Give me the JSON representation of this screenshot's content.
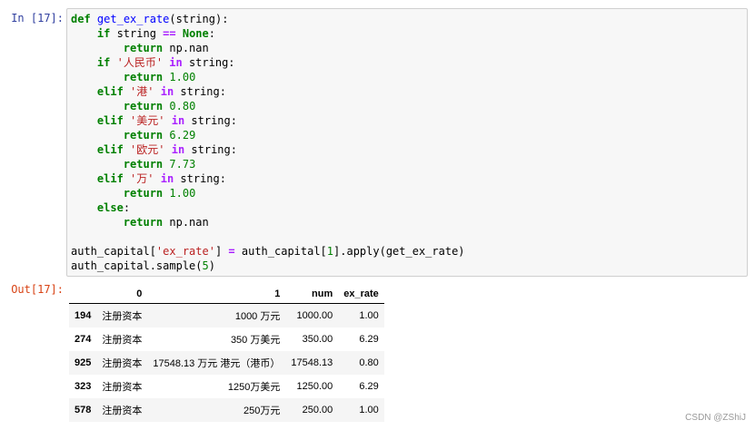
{
  "cell": {
    "in_prompt": "In  [17]:",
    "out_prompt": "Out[17]:",
    "code_lines": [
      [
        {
          "t": "def",
          "c": "kw"
        },
        {
          "t": " "
        },
        {
          "t": "get_ex_rate",
          "c": "fn"
        },
        {
          "t": "(string):"
        }
      ],
      [
        {
          "t": "    "
        },
        {
          "t": "if",
          "c": "kw"
        },
        {
          "t": " string "
        },
        {
          "t": "==",
          "c": "op"
        },
        {
          "t": " "
        },
        {
          "t": "None",
          "c": "kw"
        },
        {
          "t": ":"
        }
      ],
      [
        {
          "t": "        "
        },
        {
          "t": "return",
          "c": "kw"
        },
        {
          "t": " np.nan"
        }
      ],
      [
        {
          "t": "    "
        },
        {
          "t": "if",
          "c": "kw"
        },
        {
          "t": " "
        },
        {
          "t": "'人民币'",
          "c": "str"
        },
        {
          "t": " "
        },
        {
          "t": "in",
          "c": "op"
        },
        {
          "t": " string:"
        }
      ],
      [
        {
          "t": "        "
        },
        {
          "t": "return",
          "c": "kw"
        },
        {
          "t": " "
        },
        {
          "t": "1.00",
          "c": "num"
        }
      ],
      [
        {
          "t": "    "
        },
        {
          "t": "elif",
          "c": "kw"
        },
        {
          "t": " "
        },
        {
          "t": "'港'",
          "c": "str"
        },
        {
          "t": " "
        },
        {
          "t": "in",
          "c": "op"
        },
        {
          "t": " string:"
        }
      ],
      [
        {
          "t": "        "
        },
        {
          "t": "return",
          "c": "kw"
        },
        {
          "t": " "
        },
        {
          "t": "0.80",
          "c": "num"
        }
      ],
      [
        {
          "t": "    "
        },
        {
          "t": "elif",
          "c": "kw"
        },
        {
          "t": " "
        },
        {
          "t": "'美元'",
          "c": "str"
        },
        {
          "t": " "
        },
        {
          "t": "in",
          "c": "op"
        },
        {
          "t": " string:"
        }
      ],
      [
        {
          "t": "        "
        },
        {
          "t": "return",
          "c": "kw"
        },
        {
          "t": " "
        },
        {
          "t": "6.29",
          "c": "num"
        }
      ],
      [
        {
          "t": "    "
        },
        {
          "t": "elif",
          "c": "kw"
        },
        {
          "t": " "
        },
        {
          "t": "'欧元'",
          "c": "str"
        },
        {
          "t": " "
        },
        {
          "t": "in",
          "c": "op"
        },
        {
          "t": " string:"
        }
      ],
      [
        {
          "t": "        "
        },
        {
          "t": "return",
          "c": "kw"
        },
        {
          "t": " "
        },
        {
          "t": "7.73",
          "c": "num"
        }
      ],
      [
        {
          "t": "    "
        },
        {
          "t": "elif",
          "c": "kw"
        },
        {
          "t": " "
        },
        {
          "t": "'万'",
          "c": "str"
        },
        {
          "t": " "
        },
        {
          "t": "in",
          "c": "op"
        },
        {
          "t": " string:"
        }
      ],
      [
        {
          "t": "        "
        },
        {
          "t": "return",
          "c": "kw"
        },
        {
          "t": " "
        },
        {
          "t": "1.00",
          "c": "num"
        }
      ],
      [
        {
          "t": "    "
        },
        {
          "t": "else",
          "c": "kw"
        },
        {
          "t": ":"
        }
      ],
      [
        {
          "t": "        "
        },
        {
          "t": "return",
          "c": "kw"
        },
        {
          "t": " np.nan"
        }
      ],
      [
        {
          "t": ""
        }
      ],
      [
        {
          "t": "auth_capital["
        },
        {
          "t": "'ex_rate'",
          "c": "str"
        },
        {
          "t": "] "
        },
        {
          "t": "=",
          "c": "op"
        },
        {
          "t": " auth_capital["
        },
        {
          "t": "1",
          "c": "num"
        },
        {
          "t": "].apply(get_ex_rate)"
        }
      ],
      [
        {
          "t": "auth_capital.sample("
        },
        {
          "t": "5",
          "c": "num"
        },
        {
          "t": ")"
        }
      ]
    ]
  },
  "table": {
    "columns": [
      "",
      "0",
      "1",
      "num",
      "ex_rate"
    ],
    "rows": [
      {
        "index": "194",
        "c0": "注册资本",
        "c1": "1000 万元",
        "num": "1000.00",
        "ex_rate": "1.00"
      },
      {
        "index": "274",
        "c0": "注册资本",
        "c1": "350 万美元",
        "num": "350.00",
        "ex_rate": "6.29"
      },
      {
        "index": "925",
        "c0": "注册资本",
        "c1": "17548.13 万元 港元（港币）",
        "num": "17548.13",
        "ex_rate": "0.80"
      },
      {
        "index": "323",
        "c0": "注册资本",
        "c1": "1250万美元",
        "num": "1250.00",
        "ex_rate": "6.29"
      },
      {
        "index": "578",
        "c0": "注册资本",
        "c1": "250万元",
        "num": "250.00",
        "ex_rate": "1.00"
      }
    ]
  },
  "watermark": "CSDN @ZShiJ"
}
